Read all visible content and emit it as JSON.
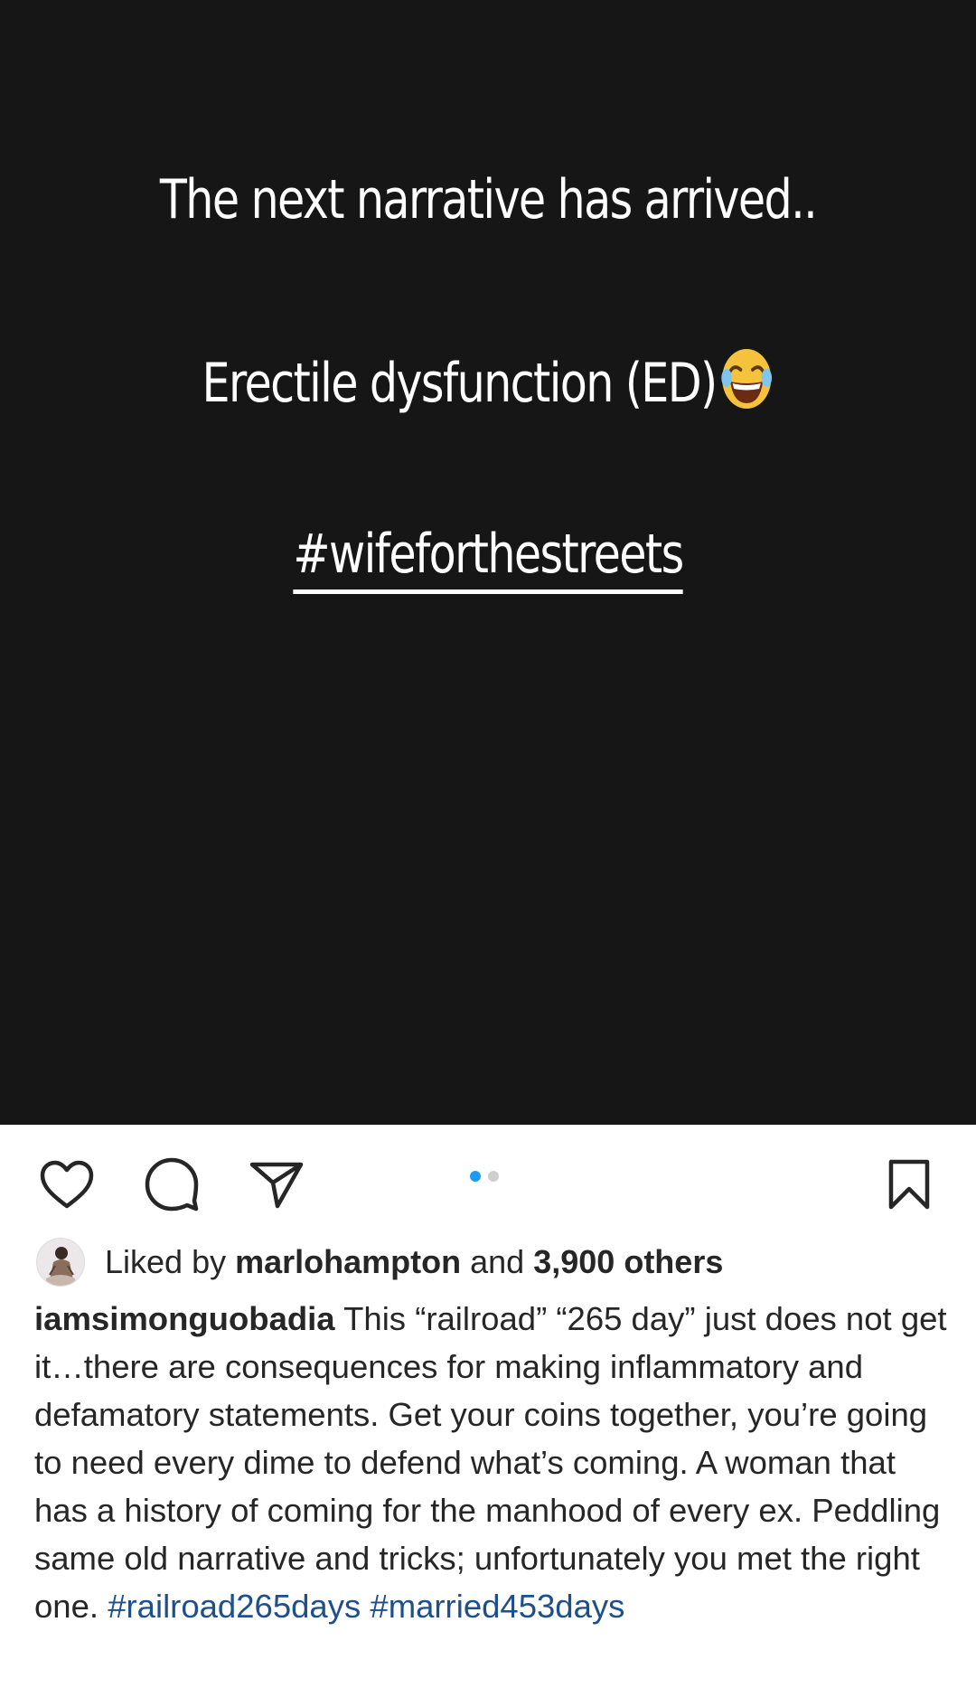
{
  "post": {
    "lines": [
      "The next narrative has arrived..",
      "Erectile dysfunction  (ED)",
      "#wifeforthestreets"
    ]
  },
  "actions": {
    "icons": [
      "heart-icon",
      "comment-icon",
      "share-icon",
      "bookmark-icon"
    ],
    "carousel": {
      "total": 2,
      "active": 1
    }
  },
  "likes": {
    "prefix": "Liked by",
    "user": "marlohampton",
    "conjunction": "and",
    "others": "3,900 others"
  },
  "caption": {
    "username": "iamsimonguobadia",
    "text": "This “railroad” “265 day” just does not get it…there are consequences for making inflammatory and defamatory statements. Get your coins together, you’re going to need every dime to defend what’s coming. A woman that has a history of coming for the manhood of every ex. Peddling same old narrative and tricks; unfortunately you met the right one.",
    "hashtags": [
      "#railroad265days",
      "#married453days"
    ]
  },
  "colors": {
    "media_bg": "#161616",
    "text": "#262626",
    "hashtag": "#1d4f8c",
    "active_dot": "#1d9bf0"
  }
}
